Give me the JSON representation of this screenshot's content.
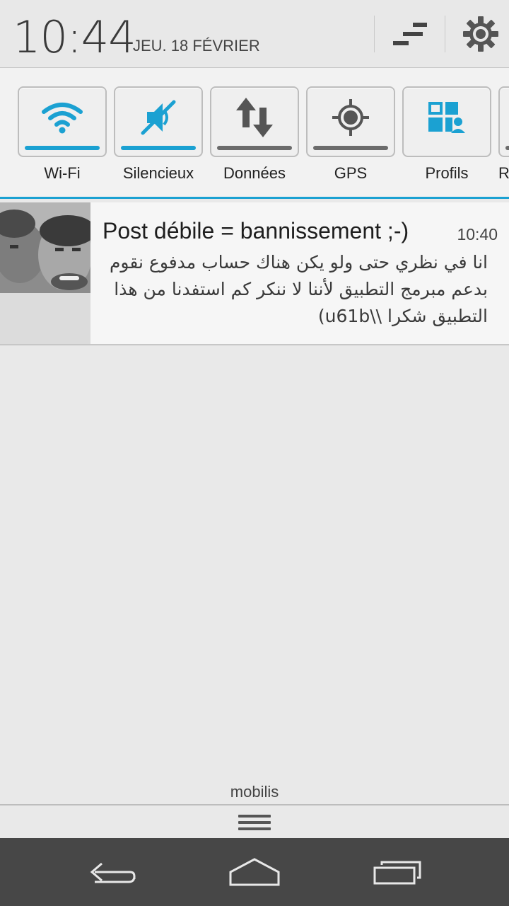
{
  "status": {
    "time": "10:44",
    "date": "JEU. 18 FÉVRIER"
  },
  "header": {
    "toggle_icon": "quick-settings-toggle-icon",
    "settings_icon": "gear-icon"
  },
  "quick_settings": [
    {
      "label": "Wi-Fi",
      "icon": "wifi-icon",
      "active": true
    },
    {
      "label": "Silencieux",
      "icon": "silent-mode-icon",
      "active": true
    },
    {
      "label": "Données",
      "icon": "data-arrows-icon",
      "active": false
    },
    {
      "label": "GPS",
      "icon": "gps-icon",
      "active": false
    },
    {
      "label": "Profils",
      "icon": "profiles-icon",
      "active": false
    },
    {
      "label": "R",
      "icon": "partial-tile-icon",
      "active": false
    }
  ],
  "notification": {
    "title": "Post débile = bannissement ;-)",
    "time": "10:40",
    "body": "انا في نظري حتى ولو يكن هناك حساب مدفوع نقوم بدعم مبرمج التطبيق لأننا لا ننكر كم استفدنا من هذا التطبيق شكرا \\\\u61b)"
  },
  "carrier": "mobilis",
  "navigation": [
    "back-icon",
    "home-icon",
    "recent-apps-icon"
  ],
  "colors": {
    "accent": "#1ba1d2",
    "header_bg": "#e8e8e8",
    "nav_bg": "#474747"
  }
}
